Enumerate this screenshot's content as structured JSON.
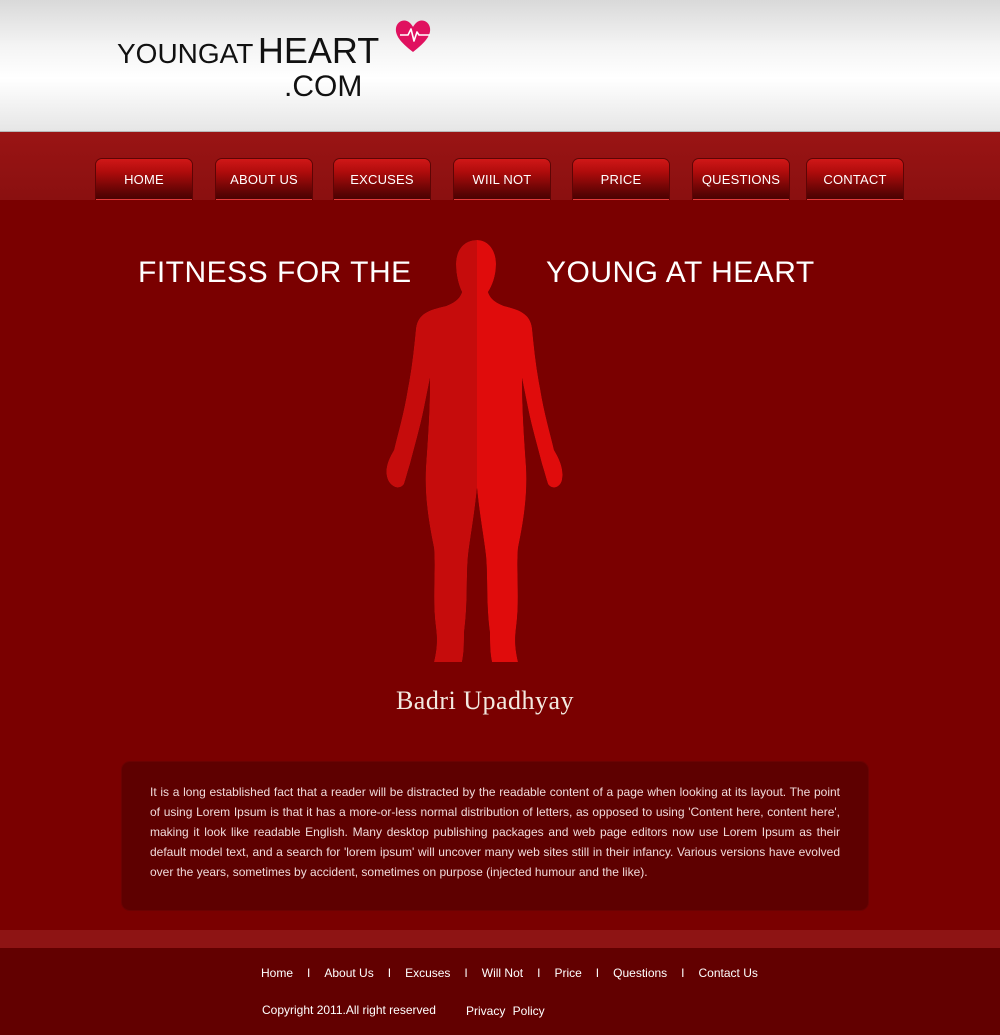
{
  "logo": {
    "young": "YOUNGAT",
    "heart": "HEART",
    "com": ".COM",
    "icon": "heart-pulse-icon",
    "heart_color": "#e0115f"
  },
  "nav": {
    "items": [
      {
        "label": "HOME"
      },
      {
        "label": "ABOUT US"
      },
      {
        "label": "EXCUSES"
      },
      {
        "label": "WIIL NOT"
      },
      {
        "label": "PRICE"
      },
      {
        "label": "QUESTIONS"
      },
      {
        "label": "CONTACT"
      }
    ]
  },
  "hero": {
    "title_left": "FITNESS FOR THE",
    "title_right": "YOUNG AT HEART",
    "figure": "human-silhouette-icon",
    "signature": "Badri Upadhyay"
  },
  "content": {
    "text": "It is a long established fact that a reader will be distracted by the readable content of a page when looking at its layout. The point of using Lorem Ipsum is that it has a more-or-less normal distribution of letters, as opposed to using 'Content here, content here', making it look like readable English. Many desktop publishing packages and web page editors now use Lorem Ipsum as their default model text, and a search for 'lorem ipsum' will uncover many web sites still in their infancy. Various versions have evolved over the years, sometimes by accident, sometimes on purpose (injected humour and the like)."
  },
  "footer": {
    "links": [
      {
        "label": "Home"
      },
      {
        "label": "About Us"
      },
      {
        "label": "Excuses"
      },
      {
        "label": "Will Not"
      },
      {
        "label": "Price"
      },
      {
        "label": "Questions"
      },
      {
        "label": "Contact Us"
      }
    ],
    "separator": "I",
    "copyright": "Copyright  2011.All right reserved",
    "privacy": "Privacy  Policy"
  },
  "colors": {
    "background": "#7a0000",
    "nav_button": "#b10c0c",
    "content_box": "#5e0000",
    "footer": "#620000",
    "figure_light": "#e00c0c",
    "figure_dark": "#c60c0c"
  }
}
